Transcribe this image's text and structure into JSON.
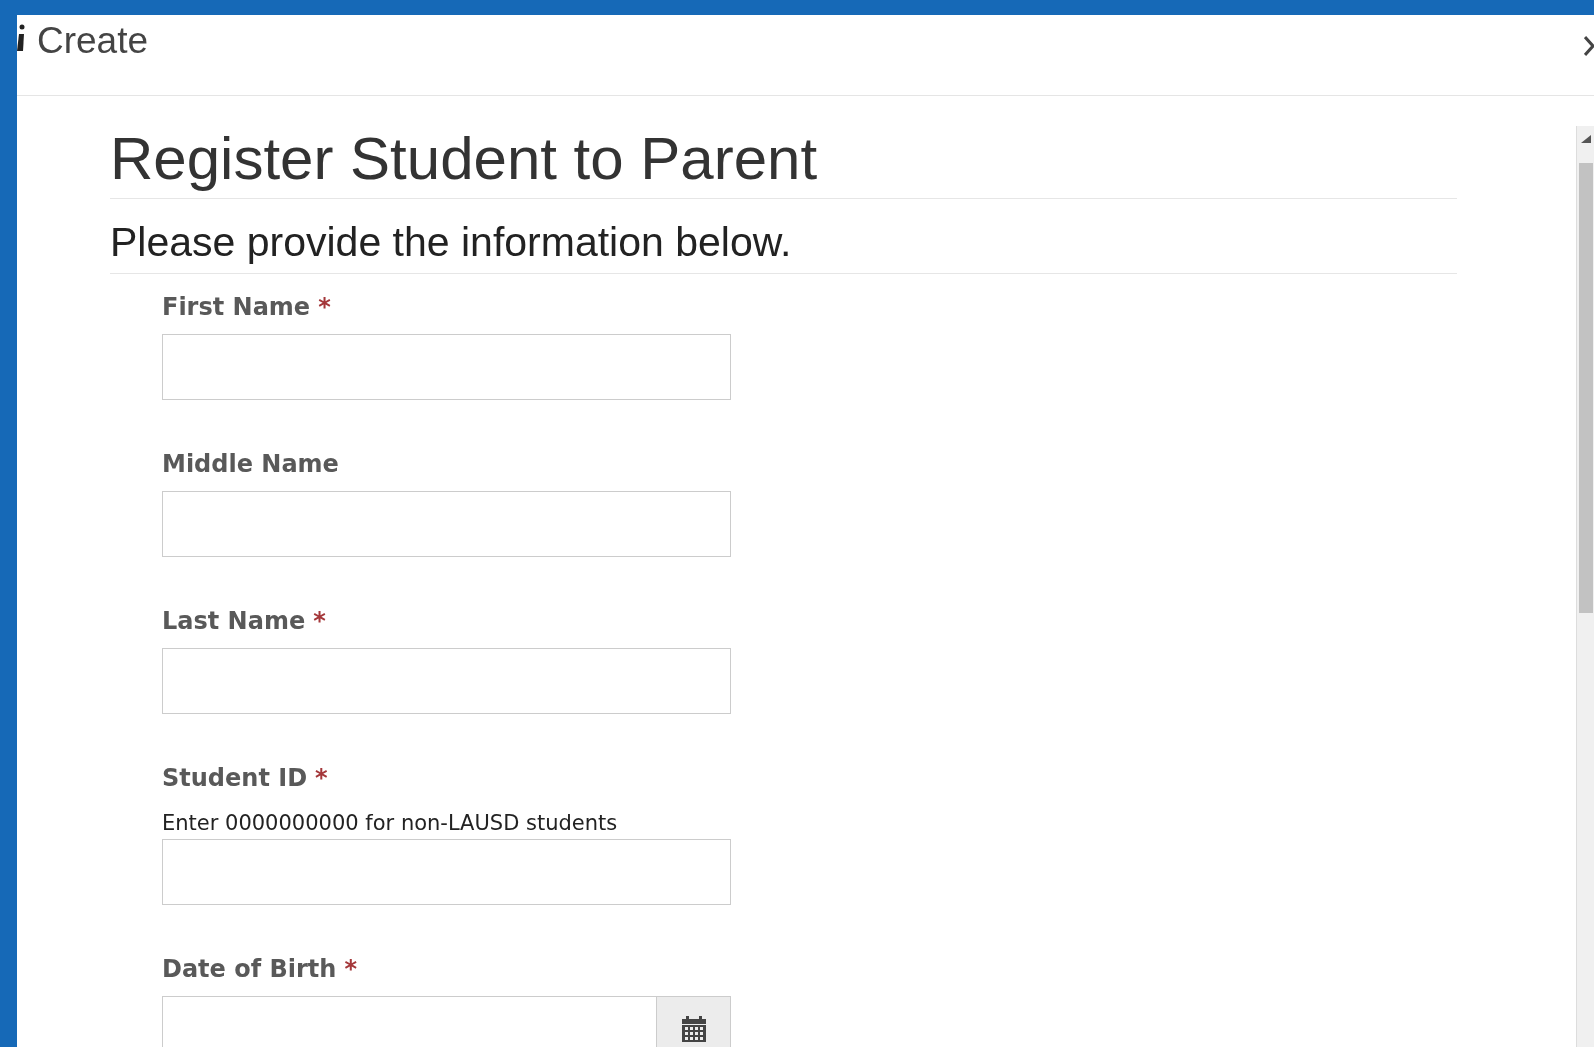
{
  "dialog": {
    "title": "Create"
  },
  "page": {
    "heading": "Register Student to Parent",
    "subheading": "Please provide the information below."
  },
  "fields": [
    {
      "kind": "text",
      "label": "First Name",
      "required_mark": "*"
    },
    {
      "kind": "text",
      "label": "Middle Name"
    },
    {
      "kind": "text",
      "label": "Last Name",
      "required_mark": "*"
    },
    {
      "kind": "text",
      "label": "Student ID",
      "required_mark": "*",
      "hint": "Enter 0000000000 for non-LAUSD students"
    },
    {
      "kind": "date",
      "label": "Date of Birth",
      "required_mark": "*"
    }
  ]
}
